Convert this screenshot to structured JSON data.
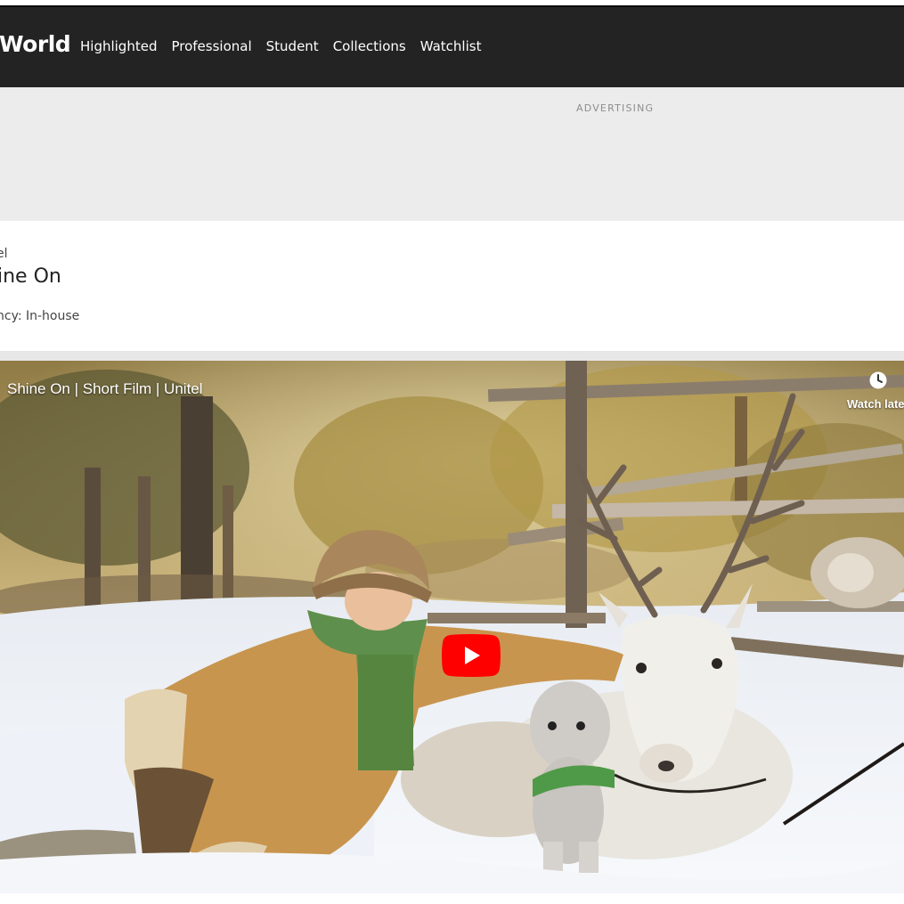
{
  "nav": {
    "brand": "World",
    "items": [
      {
        "label": "Highlighted"
      },
      {
        "label": "Professional"
      },
      {
        "label": "Student"
      },
      {
        "label": "Collections"
      },
      {
        "label": "Watchlist"
      }
    ]
  },
  "ad": {
    "label": "ADVERTISING"
  },
  "entry": {
    "brand": "el",
    "title": "ine On",
    "agency": "ncy: In-house"
  },
  "video": {
    "title": "Shine On | Short Film | Unitel",
    "watch_later": "Watch late",
    "icons": {
      "play": "youtube-play-icon",
      "watch_later": "clock-icon"
    }
  },
  "colors": {
    "nav_bg": "#232323",
    "ad_bg": "#ececec",
    "play_red": "#ff0000"
  }
}
